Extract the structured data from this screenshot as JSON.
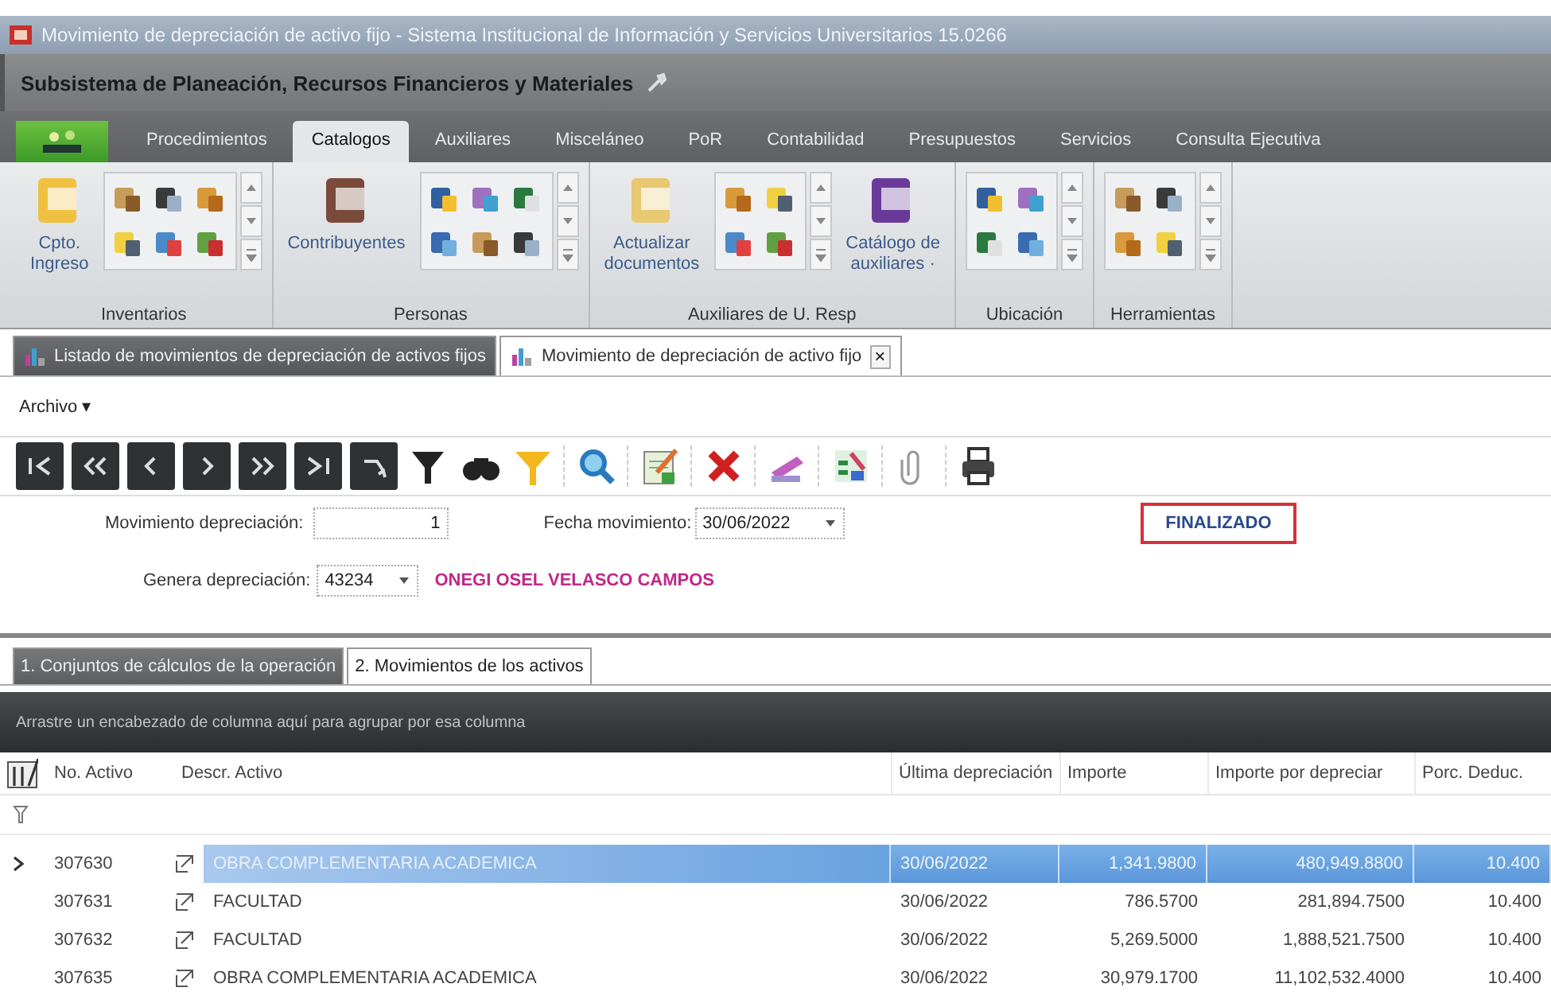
{
  "window": {
    "title": "Movimiento de depreciación de activo fijo - Sistema Institucional de Información y Servicios Universitarios 15.0266"
  },
  "subsystem": {
    "title": "Subsistema de Planeación, Recursos Financieros y Materiales"
  },
  "ribbon": {
    "tabs": [
      {
        "label": "Procedimientos",
        "selected": false
      },
      {
        "label": "Catalogos",
        "selected": true
      },
      {
        "label": "Auxiliares",
        "selected": false
      },
      {
        "label": "Misceláneo",
        "selected": false
      },
      {
        "label": "PoR",
        "selected": false
      },
      {
        "label": "Contabilidad",
        "selected": false
      },
      {
        "label": "Presupuestos",
        "selected": false
      },
      {
        "label": "Servicios",
        "selected": false
      },
      {
        "label": "Consulta Ejecutiva",
        "selected": false
      }
    ],
    "groups": [
      {
        "label": "Inventarios",
        "items": [
          {
            "kind": "button",
            "label": "Cpto.\nIngreso"
          },
          {
            "kind": "gallery"
          }
        ]
      },
      {
        "label": "Personas",
        "items": [
          {
            "kind": "button",
            "label": "Contribuyentes"
          },
          {
            "kind": "gallery"
          }
        ]
      },
      {
        "label": "Auxiliares de U. Resp",
        "items": [
          {
            "kind": "button",
            "label": "Actualizar\ndocumentos"
          },
          {
            "kind": "gallery"
          },
          {
            "kind": "button",
            "label": "Catálogo de\nauxiliares ·"
          }
        ]
      },
      {
        "label": "Ubicación",
        "items": [
          {
            "kind": "gallery"
          }
        ]
      },
      {
        "label": "Herramientas",
        "items": [
          {
            "kind": "gallery"
          }
        ]
      }
    ]
  },
  "doc_tabs": [
    {
      "label": "Listado de movimientos de depreciación de activos fijos",
      "selected": false
    },
    {
      "label": "Movimiento de depreciación de activo fijo",
      "selected": true,
      "close": "×"
    }
  ],
  "menu": {
    "label": "Archivo",
    "caret": "▾"
  },
  "form": {
    "movimiento": {
      "label": "Movimiento depreciación:",
      "value": "1"
    },
    "fecha": {
      "label": "Fecha movimiento:",
      "value": "30/06/2022"
    },
    "genera": {
      "label": "Genera depreciación:",
      "value": "43234",
      "name": "ONEGI OSEL VELASCO CAMPOS"
    },
    "status": "FINALIZADO"
  },
  "inner_tabs": [
    {
      "label": "1. Conjuntos de cálculos de la operación",
      "selected": false
    },
    {
      "label": "2. Movimientos de los activos",
      "selected": true
    }
  ],
  "grid": {
    "group_hint": "Arrastre un encabezado de columna aquí para agrupar por esa columna",
    "columns": [
      "No. Activo",
      "Descr. Activo",
      "Última depreciación",
      "Importe",
      "Importe por depreciar",
      "Porc. Deduc."
    ],
    "rows": [
      {
        "selected": true,
        "cells": [
          "307630",
          "OBRA COMPLEMENTARIA  ACADEMICA",
          "30/06/2022",
          "1,341.9800",
          "480,949.8800",
          "10.400"
        ]
      },
      {
        "selected": false,
        "cells": [
          "307631",
          "FACULTAD",
          "30/06/2022",
          "786.5700",
          "281,894.7500",
          "10.400"
        ]
      },
      {
        "selected": false,
        "cells": [
          "307632",
          "FACULTAD",
          "30/06/2022",
          "5,269.5000",
          "1,888,521.7500",
          "10.400"
        ]
      },
      {
        "selected": false,
        "cells": [
          "307635",
          "OBRA COMPLEMENTARIA  ACADEMICA",
          "30/06/2022",
          "30,979.1700",
          "11,102,532.4000",
          "10.400"
        ]
      }
    ]
  }
}
